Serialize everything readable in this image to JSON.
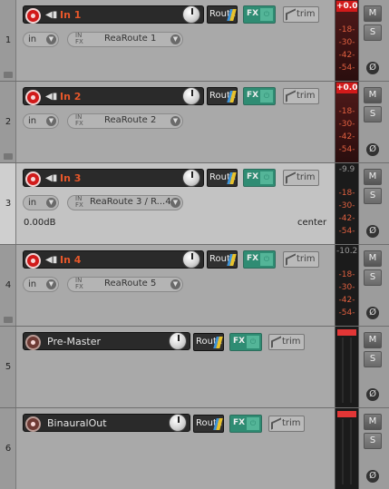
{
  "route_label": "Route",
  "fx_label": "FX",
  "trim_label": "trim",
  "mute_label": "M",
  "solo_label": "S",
  "phase_label": "Ø",
  "in_label": "in",
  "insert_in": "IN",
  "insert_fx": "FX",
  "tracks": [
    {
      "number": "1",
      "name": "In 1",
      "insert": "ReaRoute 1",
      "peak": "+0.0",
      "scale": [
        "-18-",
        "-30-",
        "-42-",
        "-54-"
      ]
    },
    {
      "number": "2",
      "name": "In 2",
      "insert": "ReaRoute 2",
      "peak": "+0.0",
      "scale": [
        "-18-",
        "-30-",
        "-42-",
        "-54-"
      ]
    },
    {
      "number": "3",
      "name": "In 3",
      "insert": "ReaRoute 3 / R...4",
      "peak": "-9.9",
      "scale": [
        "-18-",
        "-30-",
        "-42-",
        "-54-"
      ],
      "volume": "0.00dB",
      "pan": "center"
    },
    {
      "number": "4",
      "name": "In 4",
      "insert": "ReaRoute 5",
      "peak": "-10.2",
      "scale": [
        "-18-",
        "-30-",
        "-42-",
        "-54-"
      ]
    },
    {
      "number": "5",
      "name": "Pre-Master"
    },
    {
      "number": "6",
      "name": "BinauralOut"
    }
  ],
  "colors": {
    "accent_name": "#e6572a",
    "record": "#d11a1a",
    "fx_green": "#2f8c73",
    "clip": "#d21a1a"
  }
}
